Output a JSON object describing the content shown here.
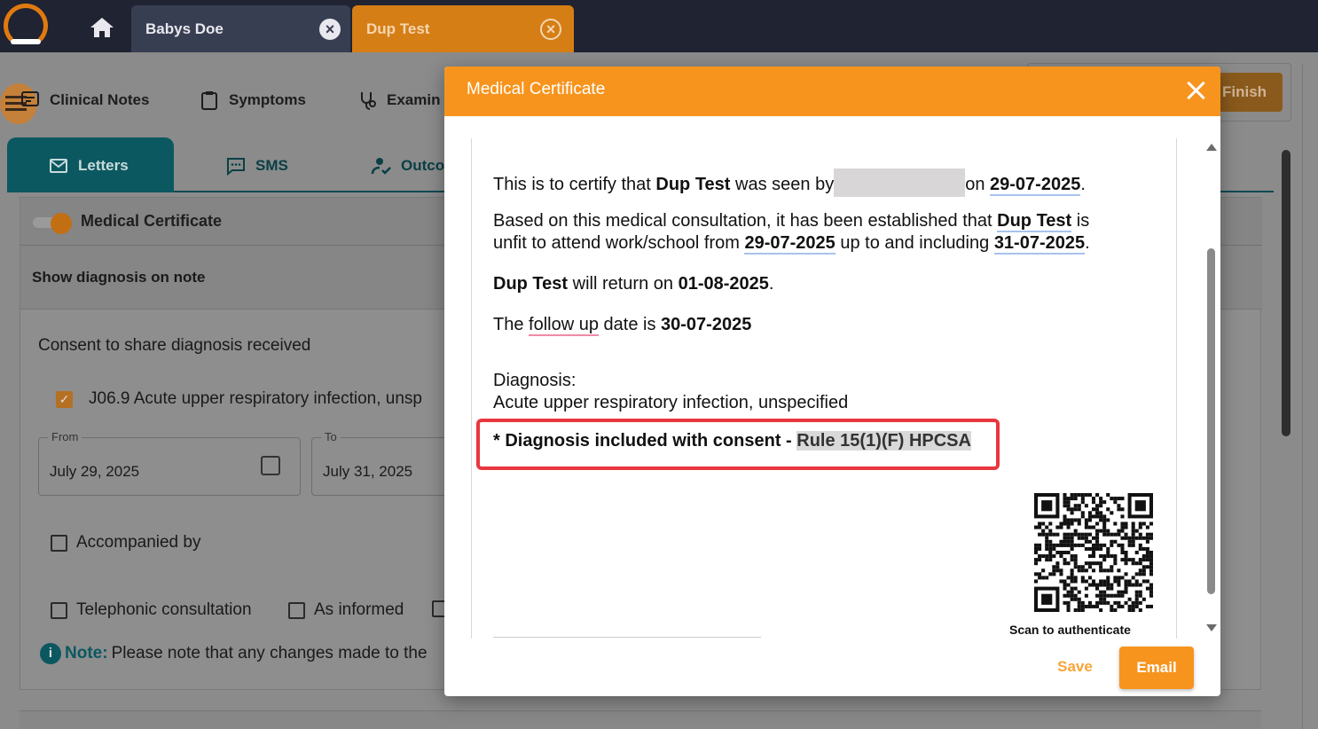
{
  "tabs": {
    "patient_tab": "Babys Doe",
    "active_tab": "Dup Test"
  },
  "nav": {
    "clinical_notes": "Clinical Notes",
    "symptoms": "Symptoms",
    "examination": "Examin",
    "finish": "Finish"
  },
  "subtabs": {
    "letters": "Letters",
    "sms": "SMS",
    "outcome": "Outco"
  },
  "panel": {
    "title": "Medical Certificate",
    "show_diagnosis": "Show diagnosis on note",
    "consent": "Consent to share diagnosis received",
    "diagnosis_item": "J06.9 Acute upper respiratory infection, unsp",
    "from_label": "From",
    "from_value": "July 29, 2025",
    "to_label": "To",
    "to_value": "July 31, 2025",
    "accompanied": "Accompanied by",
    "telephonic": "Telephonic consultation",
    "as_informed": "As informed",
    "note_label": "Note:",
    "note_text": "Please note that any changes made to the"
  },
  "modal": {
    "title": "Medical Certificate",
    "cert": {
      "line1_a": "This is to certify that ",
      "patient": "Dup Test",
      "line1_b": " was seen by",
      "line1_c": "on ",
      "seen_date": "29-07-2025",
      "line1_d": ".",
      "line2_a": "Based on this medical consultation, it has been established that ",
      "line2_b": " is",
      "line3_a": "unfit to attend work/school from ",
      "from_date": "29-07-2025",
      "line3_b": " up to and including ",
      "to_date": "31-07-2025",
      "line3_c": ".",
      "line4_a": " will return on ",
      "return_date": "01-08-2025",
      "line4_b": ".",
      "line5_a": "The ",
      "follow_up": "follow up",
      "line5_b": " date is ",
      "follow_date": "30-07-2025",
      "diagnosis_label": "Diagnosis:",
      "diagnosis_text": "Acute upper respiratory infection, unspecified",
      "consent_a": "* Diagnosis included with consent - ",
      "consent_rule": "Rule 15(1)(F) HPCSA",
      "scan": "Scan to authenticate"
    },
    "save": "Save",
    "email": "Email"
  },
  "colors": {
    "accent": "#f7941d",
    "teal": "#0b5860",
    "highlight_border": "#e8373f"
  }
}
